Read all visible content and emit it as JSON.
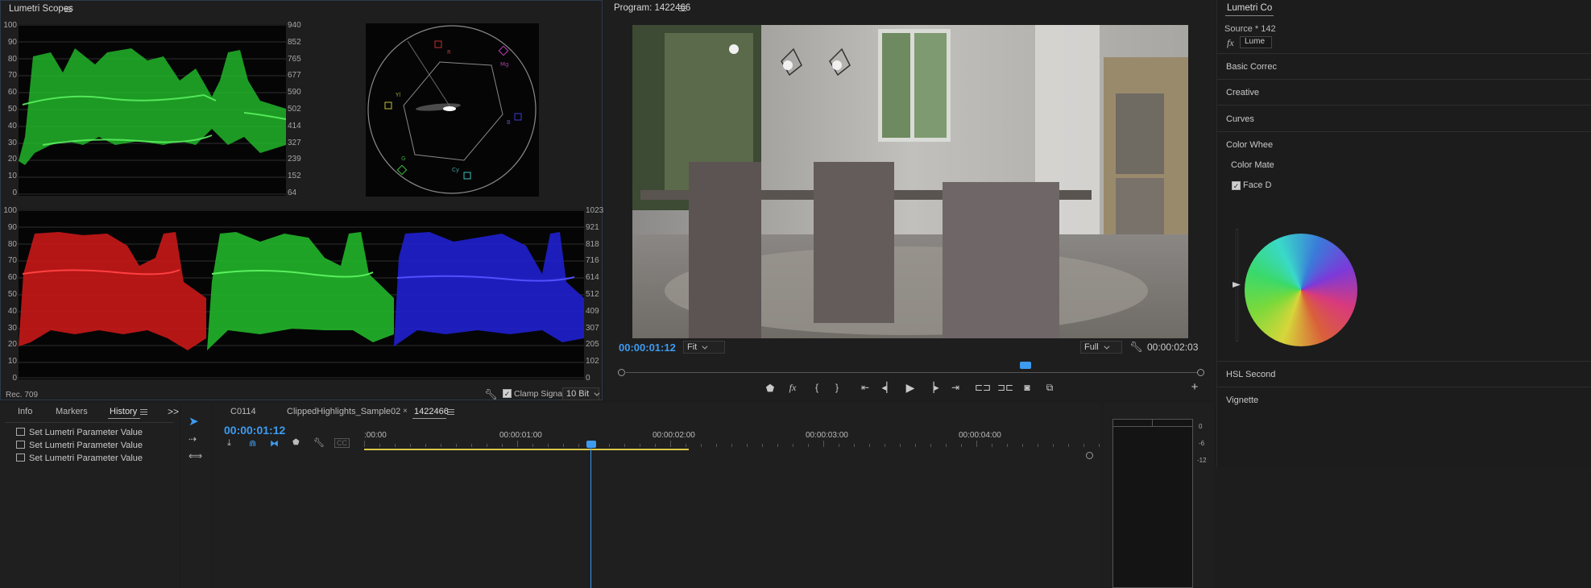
{
  "scopes_panel": {
    "title": "Lumetri Scopes",
    "waveform_left_scale": [
      "100",
      "90",
      "80",
      "70",
      "60",
      "50",
      "40",
      "30",
      "20",
      "10",
      "0"
    ],
    "waveform_right_scale": [
      "940",
      "852",
      "765",
      "677",
      "590",
      "502",
      "414",
      "327",
      "239",
      "152",
      "64"
    ],
    "vectorscope_labels": {
      "r": "R",
      "mg": "Mg",
      "yl": "Yl",
      "b": "B",
      "g": "G",
      "cy": "Cy"
    },
    "parade_left_scale": [
      "100",
      "90",
      "80",
      "70",
      "60",
      "50",
      "40",
      "30",
      "20",
      "10",
      "0"
    ],
    "parade_right_scale": [
      "1023",
      "921",
      "818",
      "716",
      "614",
      "512",
      "409",
      "307",
      "205",
      "102",
      "0"
    ],
    "footer_colorspace": "Rec. 709",
    "clamp_signal_label": "Clamp Signal",
    "bit_depth": "10 Bit"
  },
  "program_monitor": {
    "title": "Program: 1422466",
    "current_time": "00:00:01:12",
    "zoom": "Fit",
    "resolution": "Full",
    "duration": "00:00:02:03",
    "playhead_progress": 0.69
  },
  "lumetri_color": {
    "title": "Lumetri Co",
    "source": "Source * 142",
    "fx_label": "fx",
    "effect_field": "Lume",
    "sections": [
      "Basic Correc",
      "Creative",
      "Curves",
      "Color Whee",
      "Color Mate",
      "Face D",
      "HSL Second",
      "Vignette"
    ]
  },
  "bottom_left": {
    "tabs": [
      "Info",
      "Markers",
      "History"
    ],
    "active_tab": "History",
    "history_items": [
      "Set Lumetri Parameter Value",
      "Set Lumetri Parameter Value",
      "Set Lumetri Parameter Value"
    ],
    "overflow_label": ">>"
  },
  "timeline": {
    "tabs": [
      "C0114",
      "ClippedHighlights_Sample02",
      "1422466"
    ],
    "close_mark": "×",
    "current_time": "00:00:01:12",
    "ruler": [
      ":00:00",
      "00:00:01:00",
      "00:00:02:00",
      "00:00:03:00",
      "00:00:04:00"
    ],
    "audio_meter_scale": [
      "0",
      "-6",
      "-12"
    ],
    "accent_color": "#d9c94a"
  },
  "colors": {
    "accent_blue": "#3d9bf0",
    "waveform_green": "#33cc3a",
    "parade_red": "#e02020",
    "parade_blue": "#2424ea"
  }
}
